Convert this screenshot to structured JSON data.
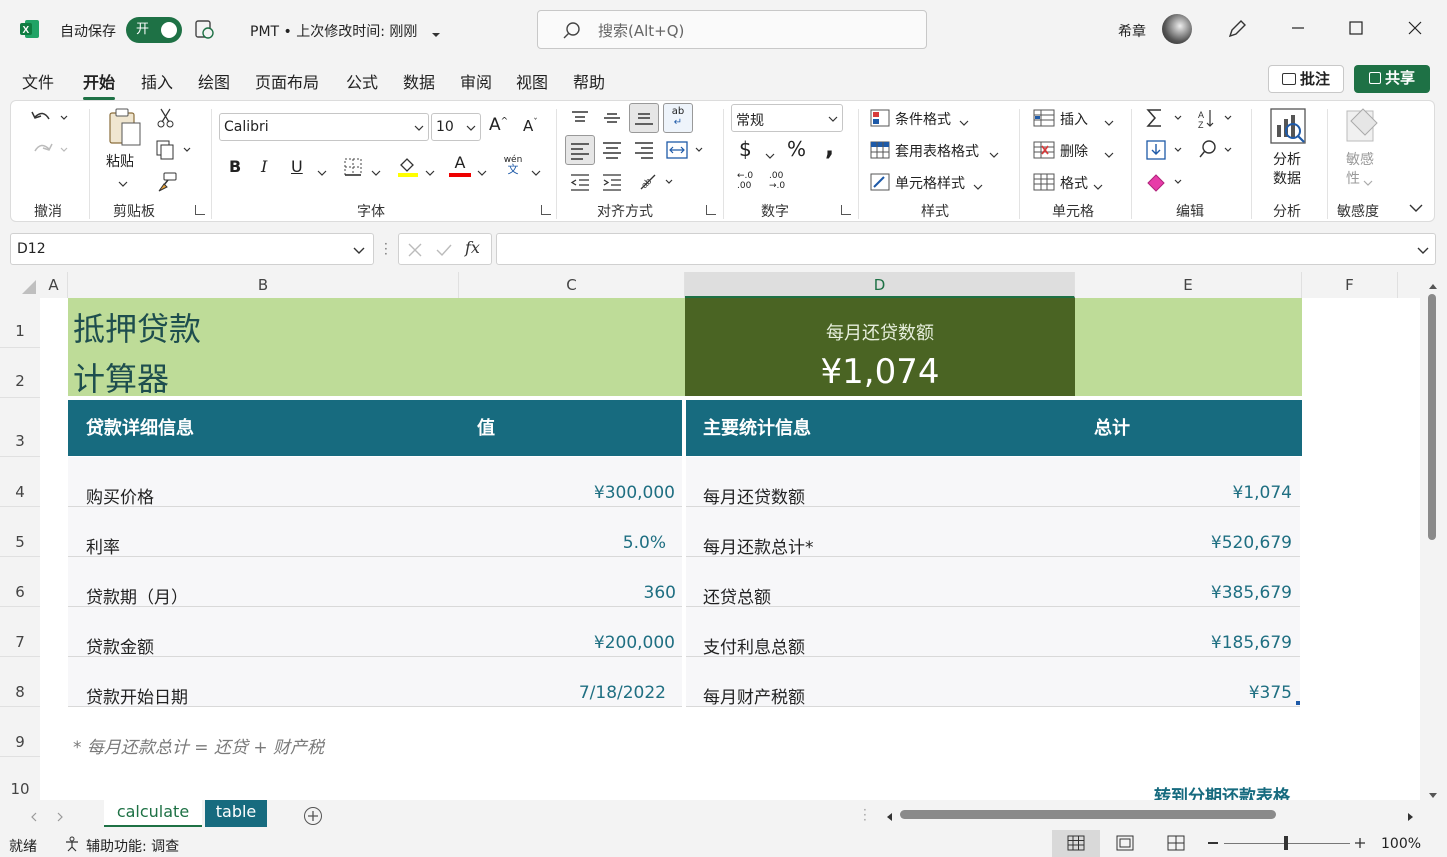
{
  "titlebar": {
    "autosave_label": "自动保存",
    "autosave_state": "开",
    "doc_title": "PMT • 上次修改时间: 刚刚",
    "search_placeholder": "搜索(Alt+Q)",
    "user_name": "希章"
  },
  "menu": {
    "items": [
      "文件",
      "开始",
      "插入",
      "绘图",
      "页面布局",
      "公式",
      "数据",
      "审阅",
      "视图",
      "帮助"
    ],
    "comments": "批注",
    "share": "共享"
  },
  "ribbon": {
    "groups": [
      "撤消",
      "剪贴板",
      "字体",
      "对齐方式",
      "数字",
      "样式",
      "单元格",
      "编辑",
      "分析",
      "敏感度"
    ],
    "paste": "粘贴",
    "font_name": "Calibri",
    "font_size": "10",
    "number_format": "常规",
    "conditional_format": "条件格式",
    "format_as_table": "套用表格格式",
    "cell_styles": "单元格样式",
    "insert": "插入",
    "delete": "删除",
    "format": "格式",
    "analyze_line1": "分析",
    "analyze_line2": "数据",
    "sensitivity_line1": "敏感",
    "sensitivity_line2": "性",
    "phonetic": "wén"
  },
  "formula_bar": {
    "name_box": "D12",
    "formula": ""
  },
  "columns": [
    "A",
    "B",
    "C",
    "D",
    "E",
    "F"
  ],
  "rows": [
    "1",
    "2",
    "3",
    "4",
    "5",
    "6",
    "7",
    "8",
    "9",
    "10"
  ],
  "sheet": {
    "title_line1": "抵押贷款",
    "title_line2": "计算器",
    "monthly_label": "每月还贷数额",
    "monthly_value": "¥1,074",
    "left_header": "贷款详细信息",
    "left_header_value": "值",
    "right_header": "主要统计信息",
    "right_header_value": "总计",
    "left_rows": [
      {
        "label": "购买价格",
        "value": "¥300,000"
      },
      {
        "label": "利率",
        "value": "5.0%"
      },
      {
        "label": "贷款期（月）",
        "value": "360"
      },
      {
        "label": "贷款金额",
        "value": "¥200,000"
      },
      {
        "label": "贷款开始日期",
        "value": "7/18/2022"
      }
    ],
    "right_rows": [
      {
        "label": "每月还贷数额",
        "value": "¥1,074"
      },
      {
        "label": "每月还款总计*",
        "value": "¥520,679"
      },
      {
        "label": "还贷总额",
        "value": "¥385,679"
      },
      {
        "label": "支付利息总额",
        "value": "¥185,679"
      },
      {
        "label": "每月财产税额",
        "value": "¥375"
      }
    ],
    "footnote": "* 每月还款总计 = 还贷 + 财产税",
    "link": "转到分期还款表格"
  },
  "sheet_tabs": [
    "calculate",
    "table"
  ],
  "status": {
    "ready": "就绪",
    "accessibility": "辅助功能: 调查",
    "zoom": "100%"
  },
  "colors": {
    "light_green": "#bedc98",
    "dark_green": "#4a6423",
    "teal": "#176b7f",
    "excel_green": "#1e7145"
  }
}
